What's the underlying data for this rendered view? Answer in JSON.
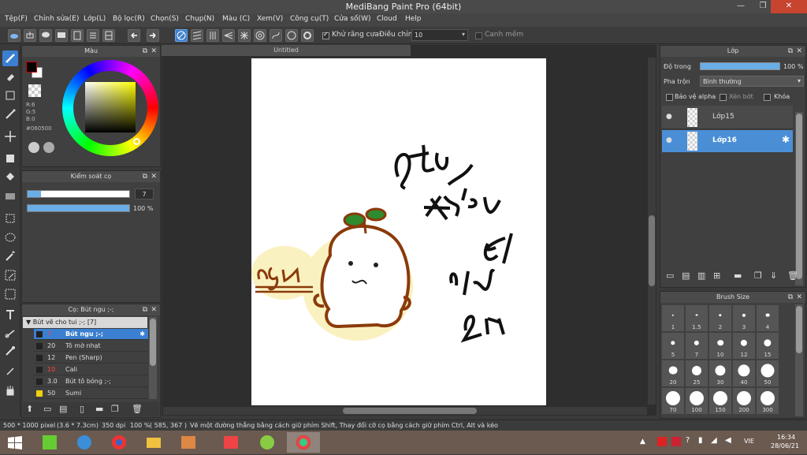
{
  "window": {
    "title": "MediBang Paint Pro (64bit)",
    "min": "—",
    "max": "❐",
    "close": "✕"
  },
  "menu": [
    "Tệp(F)",
    "Chỉnh sửa(E)",
    "Lớp(L)",
    "Bộ lọc(R)",
    "Chọn(S)",
    "Chụp(N)",
    "Màu (C)",
    "Xem(V)",
    "Công cụ(T)",
    "Cửa số(W)",
    "Cloud",
    "Help"
  ],
  "toolbar": {
    "antialias_label": "Khử răng cưa",
    "correction_label": "Điều chỉnh",
    "correction_value": "10",
    "edge_label": "Canh mềm"
  },
  "color_panel": {
    "title": "Màu",
    "r": "R:6",
    "g": "G:5",
    "b": "B:0",
    "hex": "#060500",
    "primary_color": "#060500",
    "secondary_color": "#ffffff"
  },
  "brush_control": {
    "title": "Kiểm soát cọ",
    "size": "7",
    "opacity": "100 %",
    "size_fraction": 0.07,
    "opacity_fraction": 1.0
  },
  "brush_list": {
    "title": "Cọ: Bút ngu ;-;",
    "group": "Bút vẽ cho tui ;-; [7]",
    "items": [
      {
        "size": "7",
        "name": "Bút ngu ;-;",
        "color": "#222222",
        "selected": true
      },
      {
        "size": "20",
        "name": "Tô mờ nhạt",
        "color": "#222222",
        "selected": false
      },
      {
        "size": "12",
        "name": "Pen (Sharp)",
        "color": "#222222",
        "selected": false
      },
      {
        "size": "10",
        "name": "Cali",
        "color": "#222222",
        "selected": false
      },
      {
        "size": "3.0",
        "name": "Bút tô bóng ;-;",
        "color": "#222222",
        "selected": false
      },
      {
        "size": "50",
        "name": "Sumi",
        "color": "#f0d010",
        "selected": false
      }
    ]
  },
  "document": {
    "tab": "Untitled"
  },
  "layer_panel": {
    "title": "Lớp",
    "opacity_label": "Độ trong",
    "opacity_value": "100 %",
    "blend_label": "Pha trộn",
    "blend_value": "Bình thường",
    "protect_alpha": "Bảo vệ alpha",
    "clipping": "Xén bớt",
    "lock": "Khóa",
    "layers": [
      {
        "name": "Lớp15",
        "selected": false
      },
      {
        "name": "Lớp16",
        "selected": true
      }
    ]
  },
  "brush_size_panel": {
    "title": "Brush Size",
    "sizes": [
      "1",
      "1.5",
      "2",
      "3",
      "4",
      "5",
      "7",
      "10",
      "12",
      "15",
      "20",
      "25",
      "30",
      "40",
      "50",
      "70",
      "100",
      "150",
      "200",
      "300"
    ]
  },
  "status": {
    "dimensions": "500 * 1000 pixel",
    "physical": "(3.6 * 7.3cm)",
    "dpi": "350 dpi",
    "zoom": "100 %",
    "coords": "( 585, 367 )",
    "hint": "Vẽ một đường thẳng bằng cách giữ phím Shift, Thay đổi cỡ cọ bằng cách giữ phím Ctrl, Alt và kéo"
  },
  "taskbar": {
    "lang": "VIE",
    "time": "16:34",
    "date": "28/06/21"
  }
}
